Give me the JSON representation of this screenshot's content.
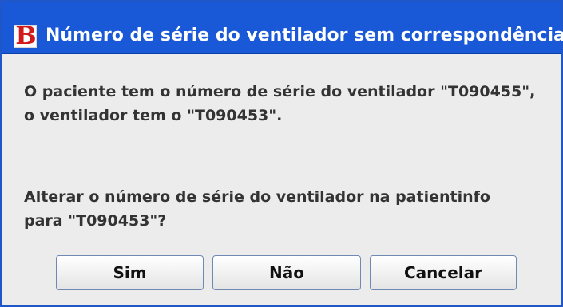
{
  "dialog": {
    "title": "Número de série do ventilador sem correspondência",
    "icon_letter": "B",
    "message_line_1": "O paciente tem o número de série do ventilador \"T090455\",",
    "message_line_2": "o ventilador tem o \"T090453\".",
    "question_line_1": "Alterar o número de série do ventilador na patientinfo",
    "question_line_2": "para \"T090453\"?"
  },
  "buttons": {
    "yes_label": "Sim",
    "no_label": "Não",
    "cancel_label": "Cancelar"
  },
  "colors": {
    "titlebar": "#1958d6",
    "window_border": "#1f57c8",
    "icon_letter": "#d11b1b"
  }
}
